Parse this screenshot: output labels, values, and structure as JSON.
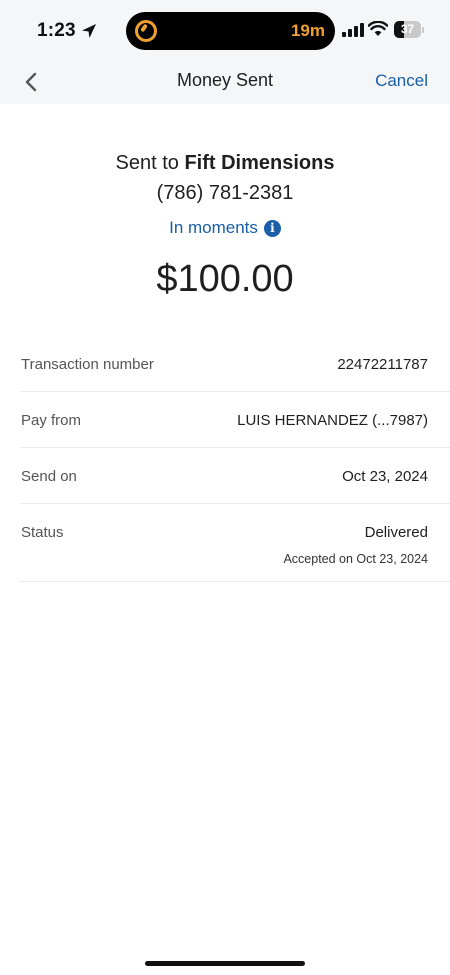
{
  "status_bar": {
    "time": "1:23",
    "island_text": "19m",
    "battery": "37",
    "battery_level": 0.37,
    "icons": [
      "location-arrow-icon",
      "timer-icon",
      "signal-icon",
      "wifi-icon",
      "battery-icon"
    ]
  },
  "header": {
    "title": "Money Sent",
    "cancel_label": "Cancel",
    "back_icon": "chevron-left-icon"
  },
  "summary": {
    "sent_prefix": "Sent to ",
    "recipient": "Fift Dimensions",
    "phone": "(786) 781-2381",
    "timing": "In moments",
    "info_icon": "info-icon",
    "amount": "$100.00"
  },
  "details": [
    {
      "label": "Transaction number",
      "value": "22472211787",
      "sub": ""
    },
    {
      "label": "Pay from",
      "value": "LUIS HERNANDEZ (...7987)",
      "sub": ""
    },
    {
      "label": "Send on",
      "value": "Oct 23, 2024",
      "sub": ""
    },
    {
      "label": "Status",
      "value": "Delivered",
      "sub": "Accepted on Oct 23, 2024"
    }
  ],
  "colors": {
    "accent": "#1a5fa8",
    "header_bg": "#f5f6f7",
    "island_accent": "#f0a030",
    "divider": "#ececec"
  }
}
